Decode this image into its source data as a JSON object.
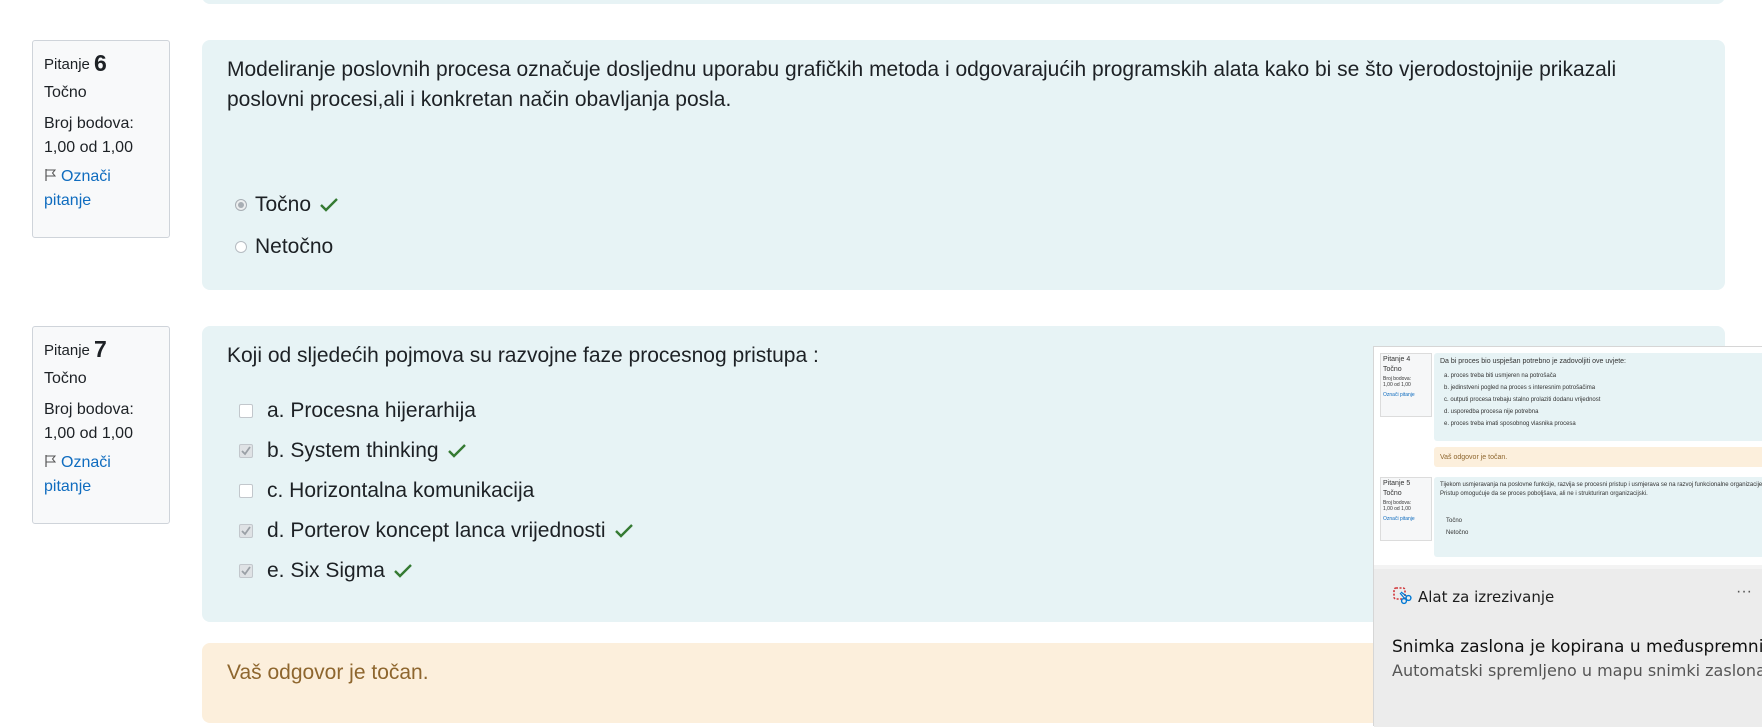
{
  "question6": {
    "label": "Pitanje",
    "number": "6",
    "state": "Točno",
    "grade_label": "Broj bodova:",
    "grade_value": "1,00 od 1,00",
    "flag_line1": "Označi",
    "flag_line2": "pitanje",
    "text_line1": "Modeliranje poslovnih procesa označuje dosljednu uporabu grafičkih metoda i odgovarajućih programskih alata kako bi se što vjerodostojnije prikazali",
    "text_line2": "poslovni procesi,ali i konkretan način obavljanja posla.",
    "options": [
      {
        "label": "Točno",
        "selected": true,
        "correct": true
      },
      {
        "label": "Netočno",
        "selected": false,
        "correct": false
      }
    ]
  },
  "question7": {
    "label": "Pitanje",
    "number": "7",
    "state": "Točno",
    "grade_label": "Broj bodova:",
    "grade_value": "1,00 od 1,00",
    "flag_line1": "Označi",
    "flag_line2": "pitanje",
    "text": "Koji od sljedećih pojmova su razvojne faze procesnog pristupa :",
    "options": [
      {
        "label": "a. Procesna hijerarhija",
        "checked": false,
        "correct": false
      },
      {
        "label": "b. System thinking",
        "checked": true,
        "correct": true
      },
      {
        "label": "c. Horizontalna komunikacija",
        "checked": false,
        "correct": false
      },
      {
        "label": "d. Porterov koncept lanca vrijednosti",
        "checked": true,
        "correct": true
      },
      {
        "label": "e. Six Sigma",
        "checked": true,
        "correct": true
      }
    ],
    "feedback": "Vaš odgovor je točan."
  },
  "snipping_tool": {
    "app_name": "Alat za izrezivanje",
    "more": "···",
    "title": "Snimka zaslona je kopirana u međuspremnik",
    "subtitle": "Automatski spremljeno u mapu snimki zaslona.",
    "thumbnail": {
      "q4_label": "Pitanje 4",
      "q4_state": "Točno",
      "q4_grade": "Broj bodova:",
      "q4_grade_value": "1,00 od 1,00",
      "q4_flag": "Označi pitanje",
      "q4_text": "Da bi proces bio uspješan potrebno je zadovoljiti ove uvjete:",
      "q4_options": [
        "a. proces treba biti usmjeren na potrošača",
        "b. jedinstveni pogled na proces s interesnim potrošačima",
        "c. outputi procesa trebaju stalno prolaziti dodanu vrijednost",
        "d. usporedba procesa nije potrebna",
        "e. proces treba imati sposobnog vlasnika procesa"
      ],
      "q4_feedback": "Vaš odgovor je točan.",
      "q5_label": "Pitanje 5",
      "q5_state": "Točno",
      "q5_grade": "Broj bodova:",
      "q5_grade_value": "1,00 od 1,00",
      "q5_flag": "Označi pitanje",
      "q5_text1": "Tijekom usmjeravanja na poslovne funkcije, razvija se procesni pristup i usmjerava se na razvoj funkcionalne organizacije.",
      "q5_text2": "Pristup omogućuje da se proces poboljšava, ali ne i strukturiran organizacijski.",
      "q5_options": [
        "Točno",
        "Netočno"
      ]
    }
  },
  "colors": {
    "question_bg": "#e7f3f5",
    "feedback_bg": "#fcefdc",
    "feedback_text": "#8e662e",
    "correct_tick": "#357a32",
    "link": "#0f6cbf"
  }
}
